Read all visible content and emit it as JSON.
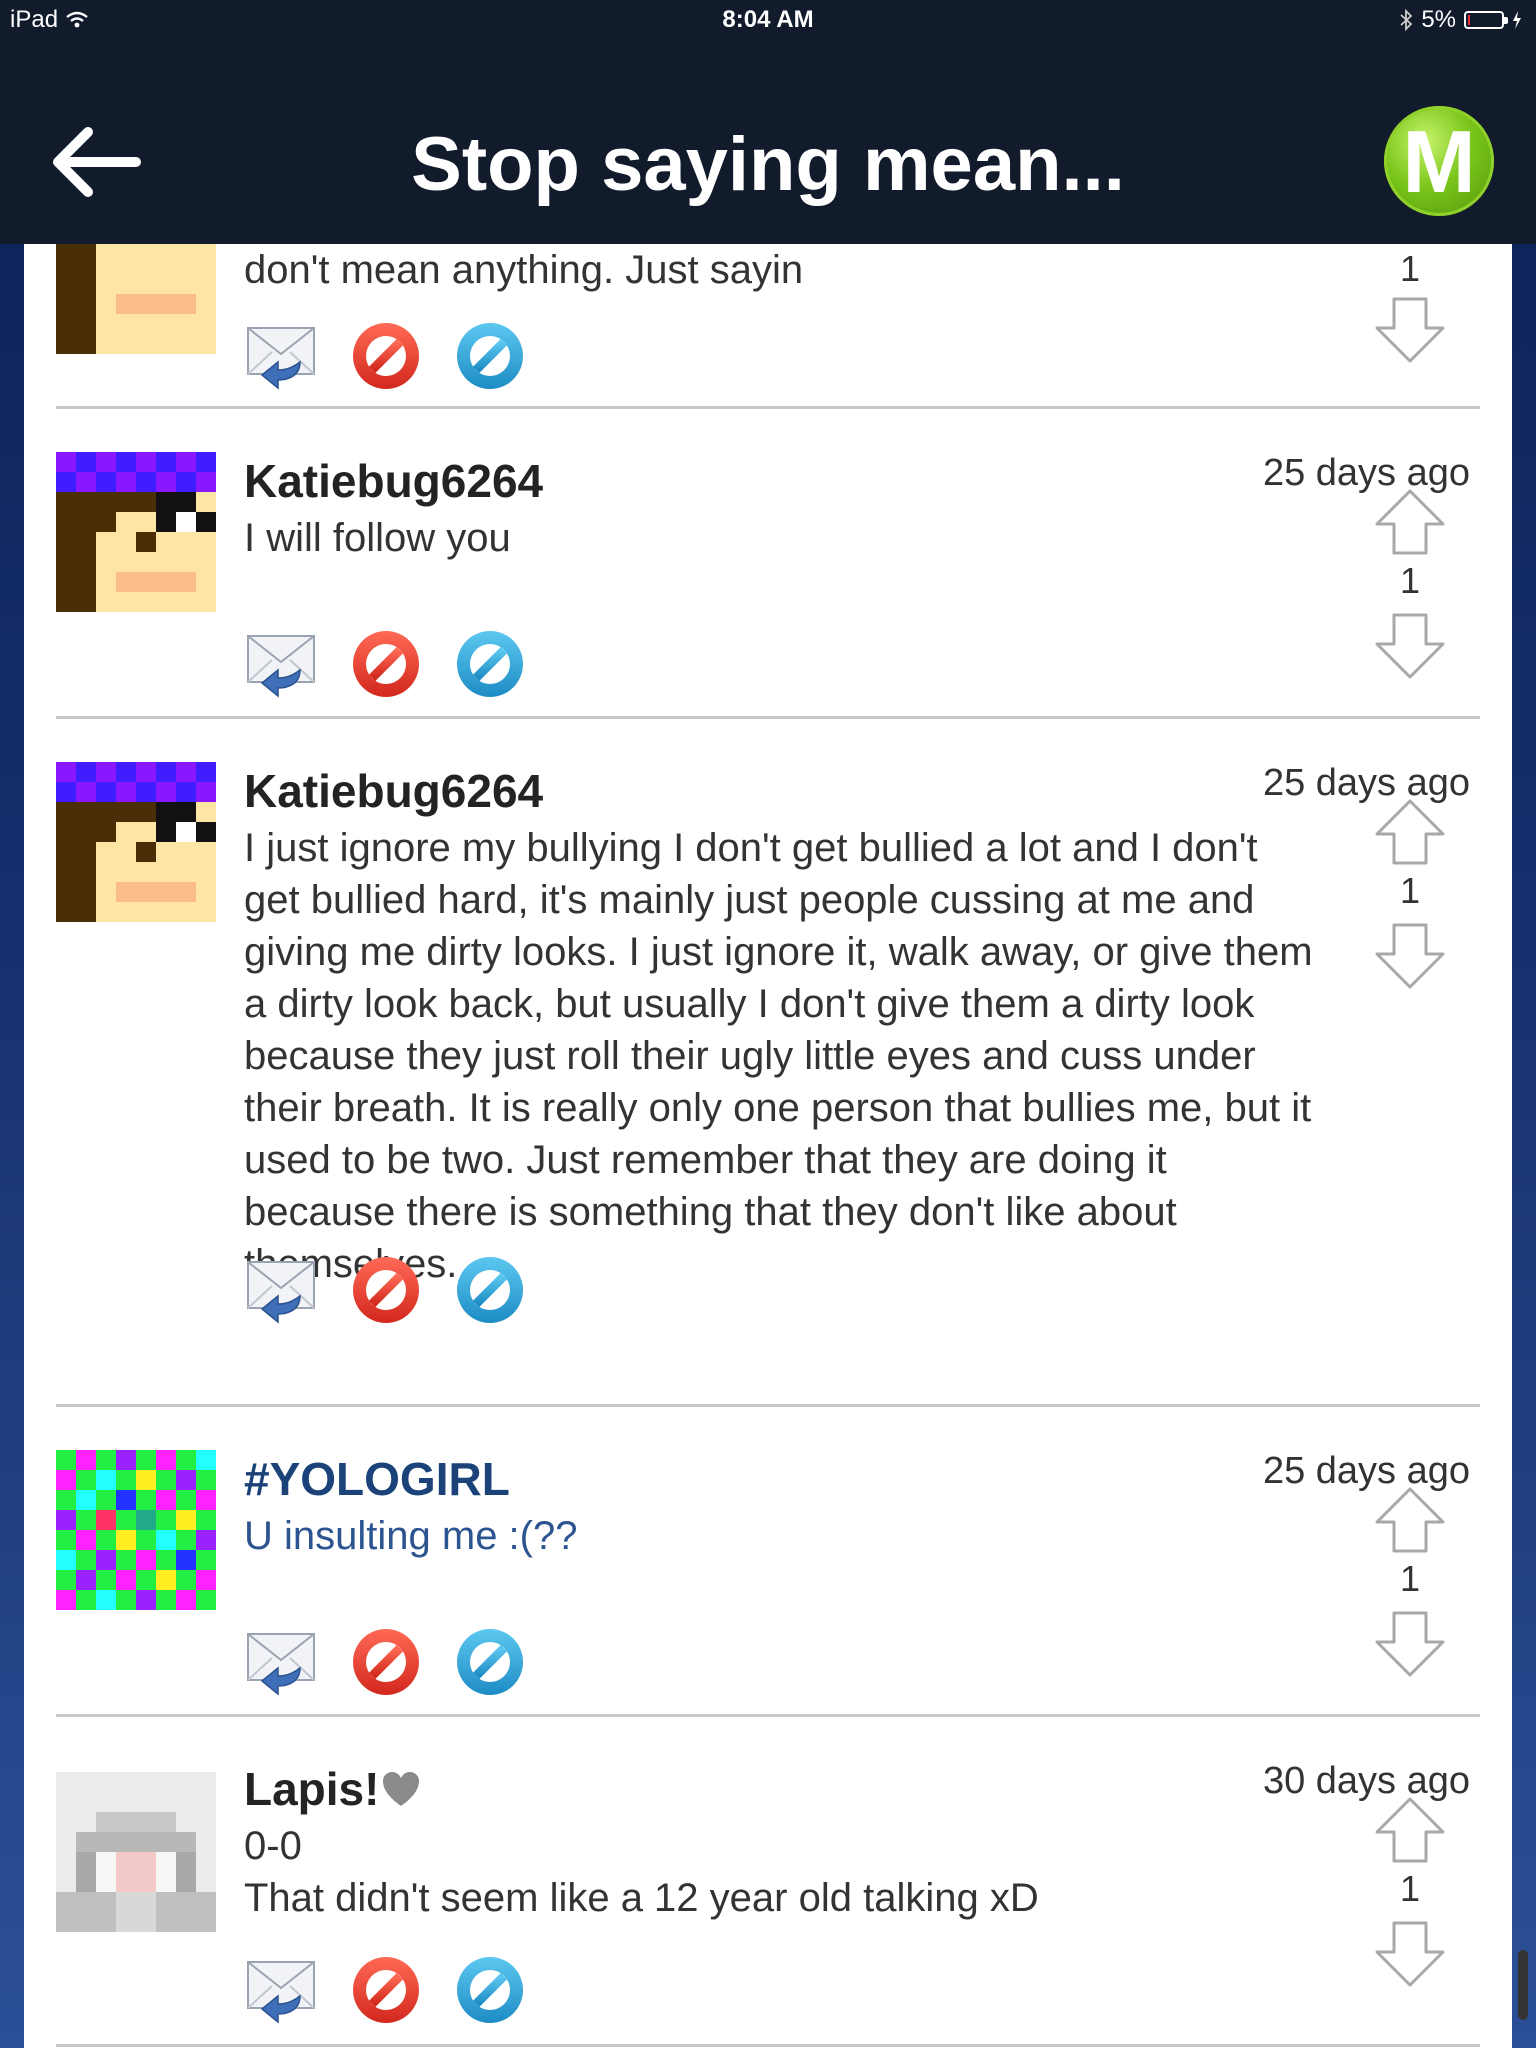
{
  "status_bar": {
    "device": "iPad",
    "time": "8:04 AM",
    "battery": "5%"
  },
  "header": {
    "title": "Stop saying mean...",
    "logo_letter": "M"
  },
  "comments": [
    {
      "author": "",
      "time": "",
      "text": "don't mean anything. Just sayin",
      "votes": "1"
    },
    {
      "author": "Katiebug6264",
      "time": "25 days ago",
      "text": "I will follow you",
      "votes": "1"
    },
    {
      "author": "Katiebug6264",
      "time": "25 days ago",
      "text": "I just ignore my bullying I don't get bullied a lot and I don't get bullied hard, it's mainly just people cussing at me and giving me dirty looks. I just ignore it, walk away, or give them a dirty look back, but usually I don't give them a dirty look because they just roll their ugly little eyes and cuss under their breath. It is really only one person that bullies me, but it used to be two. Just remember that they are doing it because there is something that they don't like about themselves.",
      "votes": "1"
    },
    {
      "author": "#YOLOGIRL",
      "time": "25 days ago",
      "text": "U insulting me :(??",
      "votes": "1"
    },
    {
      "author": "Lapis!",
      "time": "30 days ago",
      "text_line1": "0-0",
      "text_line2": "That didn't seem like a 12 year old talking xD",
      "votes": "1"
    }
  ],
  "icons": {
    "reply": "reply-envelope-icon",
    "block": "block-red-icon",
    "report": "block-blue-icon",
    "upvote": "upvote-arrow-icon",
    "downvote": "downvote-arrow-icon",
    "heart": "heart-icon"
  },
  "colors": {
    "nav_bg": "#121b2b",
    "accent_green": "#7bc61c",
    "link_blue": "#1b4379",
    "block_red": "#e53a2f",
    "block_blue": "#2aa3d8"
  }
}
